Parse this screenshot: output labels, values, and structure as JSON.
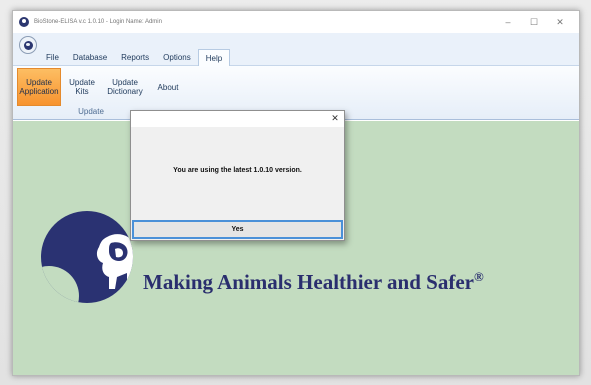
{
  "window": {
    "title": "BioStone-ELISA v.c 1.0.10 - Login Name: Admin",
    "controls": {
      "minimize": "–",
      "maximize": "☐",
      "close": "✕"
    }
  },
  "menu": {
    "tabs": [
      {
        "label": "File"
      },
      {
        "label": "Database"
      },
      {
        "label": "Reports"
      },
      {
        "label": "Options"
      },
      {
        "label": "Help",
        "active": true
      }
    ]
  },
  "ribbon": {
    "buttons": [
      {
        "line1": "Update",
        "line2": "Application",
        "selected": true
      },
      {
        "line1": "Update",
        "line2": "Kits"
      },
      {
        "line1": "Update",
        "line2": "Dictionary"
      },
      {
        "line1": "About",
        "line2": ""
      }
    ],
    "group_label": "Update"
  },
  "dialog": {
    "close": "✕",
    "message": "You are using the latest 1.0.10 version.",
    "yes_label": "Yes"
  },
  "slogan": {
    "text": "Making Animals Healthier and Safer",
    "mark": "®"
  },
  "colors": {
    "accent": "#f7932f",
    "background": "#c3dcc0",
    "brand": "#2a3272",
    "focus": "#4a90d8"
  },
  "icons": {
    "app": "biostone-logo-icon",
    "logo": "lion-logo-icon"
  }
}
